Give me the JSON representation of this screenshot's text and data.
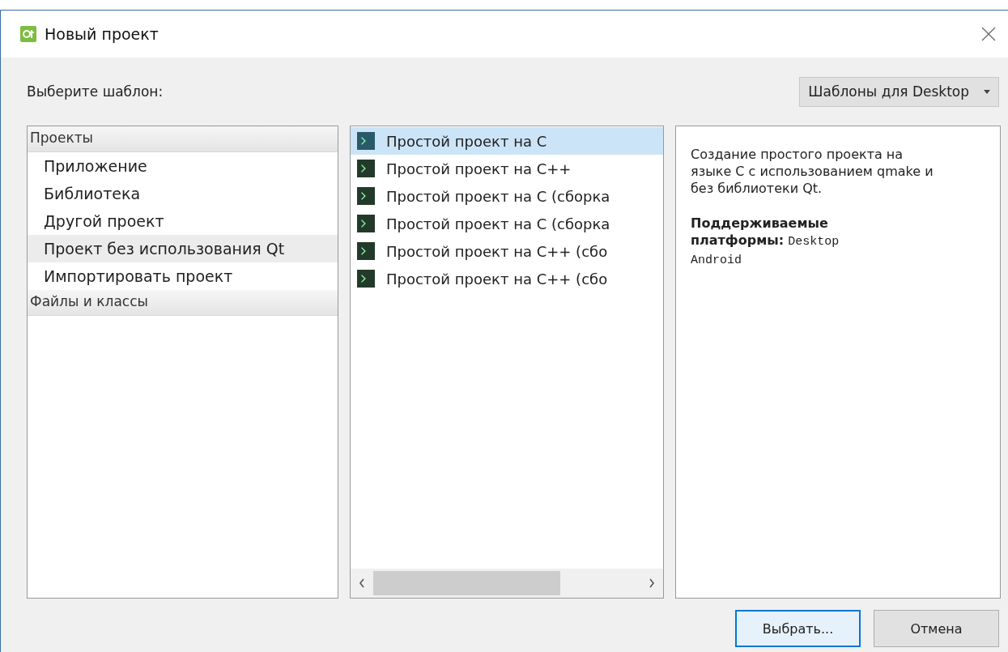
{
  "window": {
    "title": "Новый проект"
  },
  "prompt": "Выберите шаблон:",
  "filter": {
    "value": "Шаблоны для Desktop"
  },
  "categories": [
    {
      "label": "Проекты",
      "children": [
        {
          "label": "Приложение",
          "selected": false
        },
        {
          "label": "Библиотека",
          "selected": false
        },
        {
          "label": "Другой проект",
          "selected": false
        },
        {
          "label": "Проект без использования Qt",
          "selected": true
        },
        {
          "label": "Импортировать проект",
          "selected": false
        }
      ]
    },
    {
      "label": "Файлы и классы"
    }
  ],
  "templates": [
    {
      "label": "Простой проект на C",
      "selected": true
    },
    {
      "label": "Простой проект на C++",
      "selected": false
    },
    {
      "label": "Простой проект на C (сборка",
      "selected": false
    },
    {
      "label": "Простой проект на C (сборка",
      "selected": false
    },
    {
      "label": "Простой проект на C++ (сбо",
      "selected": false
    },
    {
      "label": "Простой проект на C++ (сбо",
      "selected": false
    }
  ],
  "description": {
    "text": "Создание простого проекта на языке C с использованием qmake и без библиотеки Qt.",
    "platforms_label": "Поддерживаемые платформы:",
    "platforms": "Desktop Android"
  },
  "buttons": [
    {
      "label": "Выбрать...",
      "default": true
    },
    {
      "label": "Отмена",
      "default": false
    }
  ]
}
